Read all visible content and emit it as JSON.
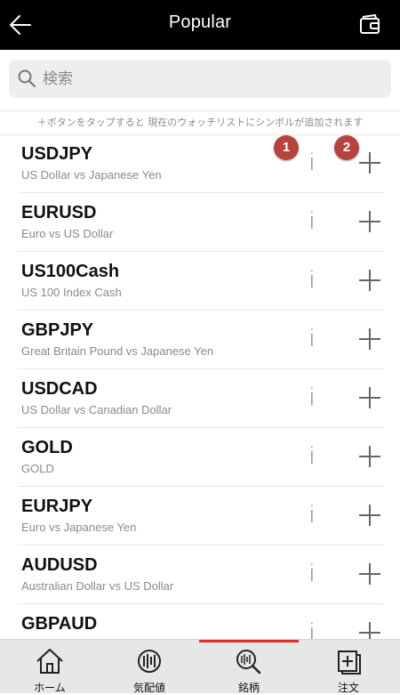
{
  "header": {
    "title": "Popular"
  },
  "search": {
    "placeholder": "検索"
  },
  "hint": "＋ボタンをタップすると 現在のウォッチリストにシンボルが追加されます",
  "symbols": [
    {
      "symbol": "USDJPY",
      "description": "US Dollar vs Japanese Yen"
    },
    {
      "symbol": "EURUSD",
      "description": "Euro vs US Dollar"
    },
    {
      "symbol": "US100Cash",
      "description": "US 100 Index Cash"
    },
    {
      "symbol": "GBPJPY",
      "description": "Great Britain Pound vs Japanese Yen"
    },
    {
      "symbol": "USDCAD",
      "description": "US Dollar vs Canadian Dollar"
    },
    {
      "symbol": "GOLD",
      "description": "GOLD"
    },
    {
      "symbol": "EURJPY",
      "description": "Euro vs Japanese Yen"
    },
    {
      "symbol": "AUDUSD",
      "description": "Australian Dollar vs US Dollar"
    },
    {
      "symbol": "GBPAUD",
      "description": ""
    }
  ],
  "row_buttons": {
    "info_label": "i"
  },
  "badges": {
    "first": "1",
    "second": "2"
  },
  "nav": {
    "items": [
      {
        "label": "ホーム",
        "icon": "home-icon"
      },
      {
        "label": "気配値",
        "icon": "quotes-icon"
      },
      {
        "label": "銘柄",
        "icon": "symbols-search-icon"
      },
      {
        "label": "注文",
        "icon": "order-icon"
      }
    ],
    "active_index": 2
  },
  "colors": {
    "topbar": "#000000",
    "badge": "#b5443f",
    "active_indicator": "#e0312b"
  }
}
